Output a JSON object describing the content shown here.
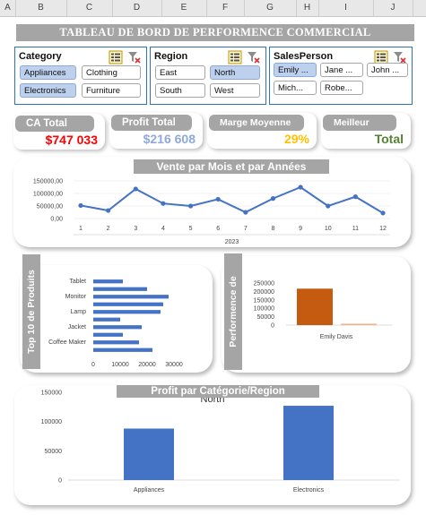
{
  "sheet": {
    "columns": [
      "A",
      "B",
      "C",
      "D",
      "E",
      "F",
      "G",
      "H",
      "I",
      "J"
    ]
  },
  "dashboard": {
    "title": "TABLEAU DE BORD DE PERFORMENCE COMMERCIAL"
  },
  "slicers": {
    "category": {
      "title": "Category",
      "items": [
        {
          "label": "Appliances",
          "selected": true
        },
        {
          "label": "Clothing",
          "selected": false
        },
        {
          "label": "Electronics",
          "selected": true
        },
        {
          "label": "Furniture",
          "selected": false
        }
      ]
    },
    "region": {
      "title": "Region",
      "items": [
        {
          "label": "East",
          "selected": false
        },
        {
          "label": "North",
          "selected": true
        },
        {
          "label": "South",
          "selected": false
        },
        {
          "label": "West",
          "selected": false
        }
      ]
    },
    "salesperson": {
      "title": "SalesPerson",
      "items": [
        {
          "label": "Emily ...",
          "selected": true
        },
        {
          "label": "Jane ...",
          "selected": false
        },
        {
          "label": "John ...",
          "selected": false
        },
        {
          "label": "Mich...",
          "selected": false
        },
        {
          "label": "Robe...",
          "selected": false
        }
      ]
    },
    "icons": [
      "multi-select-icon",
      "clear-filter-icon"
    ]
  },
  "kpis": {
    "ca_total": {
      "label": "CA Total",
      "value": "$747 033",
      "color": "#ff0000"
    },
    "profit_total": {
      "label": "Profit Total",
      "value": "$216 608",
      "color": "#8ea9db"
    },
    "marge": {
      "label": "Marge Moyenne",
      "value": "29%",
      "color": "#ffc000"
    },
    "meilleur": {
      "label": "Meilleur",
      "value": "Total",
      "color": "#548235"
    }
  },
  "charts": {
    "line": {
      "title": "Vente par Mois et par Années"
    },
    "top10": {
      "title": "Top 10 de Produits"
    },
    "perf": {
      "title": "Performence de"
    },
    "profit": {
      "title": "Profit par Catégorie/Region",
      "inner_title": "North"
    }
  },
  "chart_data": [
    {
      "type": "line",
      "title": "Vente par Mois et par Années",
      "categories": [
        "1",
        "2",
        "3",
        "4",
        "5",
        "6",
        "7",
        "8",
        "9",
        "10",
        "11",
        "12"
      ],
      "group_label": "2023",
      "values": [
        52000,
        32000,
        118000,
        60000,
        50000,
        77000,
        25000,
        80000,
        125000,
        50000,
        87000,
        22000
      ],
      "y_ticks": [
        "0,00",
        "50000,00",
        "100000,00",
        "150000,00"
      ],
      "ylim": [
        0,
        150000
      ],
      "color": "#4472c4"
    },
    {
      "type": "bar",
      "orientation": "horizontal",
      "title": "Top 10 de Produits",
      "category_labels": [
        "Tablet",
        "",
        "Monitor",
        "",
        "Lamp",
        "",
        "Jacket",
        "",
        "Coffee Maker",
        ""
      ],
      "values": [
        11000,
        20000,
        28000,
        26000,
        25000,
        10000,
        18000,
        11000,
        17000,
        22000
      ],
      "x_ticks": [
        "0",
        "10000",
        "20000",
        "30000"
      ],
      "xlim": [
        0,
        30000
      ],
      "color": "#4472c4"
    },
    {
      "type": "bar",
      "title": "Performence de",
      "categories": [
        "Emily Davis"
      ],
      "series": [
        {
          "values": [
            216608
          ],
          "color": "#c55a11"
        },
        {
          "values": [
            8000
          ],
          "color": "#f4b183"
        }
      ],
      "y_ticks": [
        "0",
        "50000",
        "100000",
        "150000",
        "200000",
        "250000"
      ],
      "ylim": [
        0,
        250000
      ]
    },
    {
      "type": "bar",
      "title": "Profit par Catégorie/Region",
      "subtitle": "North",
      "categories": [
        "Appliances",
        "Electronics"
      ],
      "values": [
        88000,
        127000
      ],
      "y_ticks": [
        "0",
        "50000",
        "100000",
        "150000"
      ],
      "ylim": [
        0,
        150000
      ],
      "color": "#4472c4"
    }
  ]
}
